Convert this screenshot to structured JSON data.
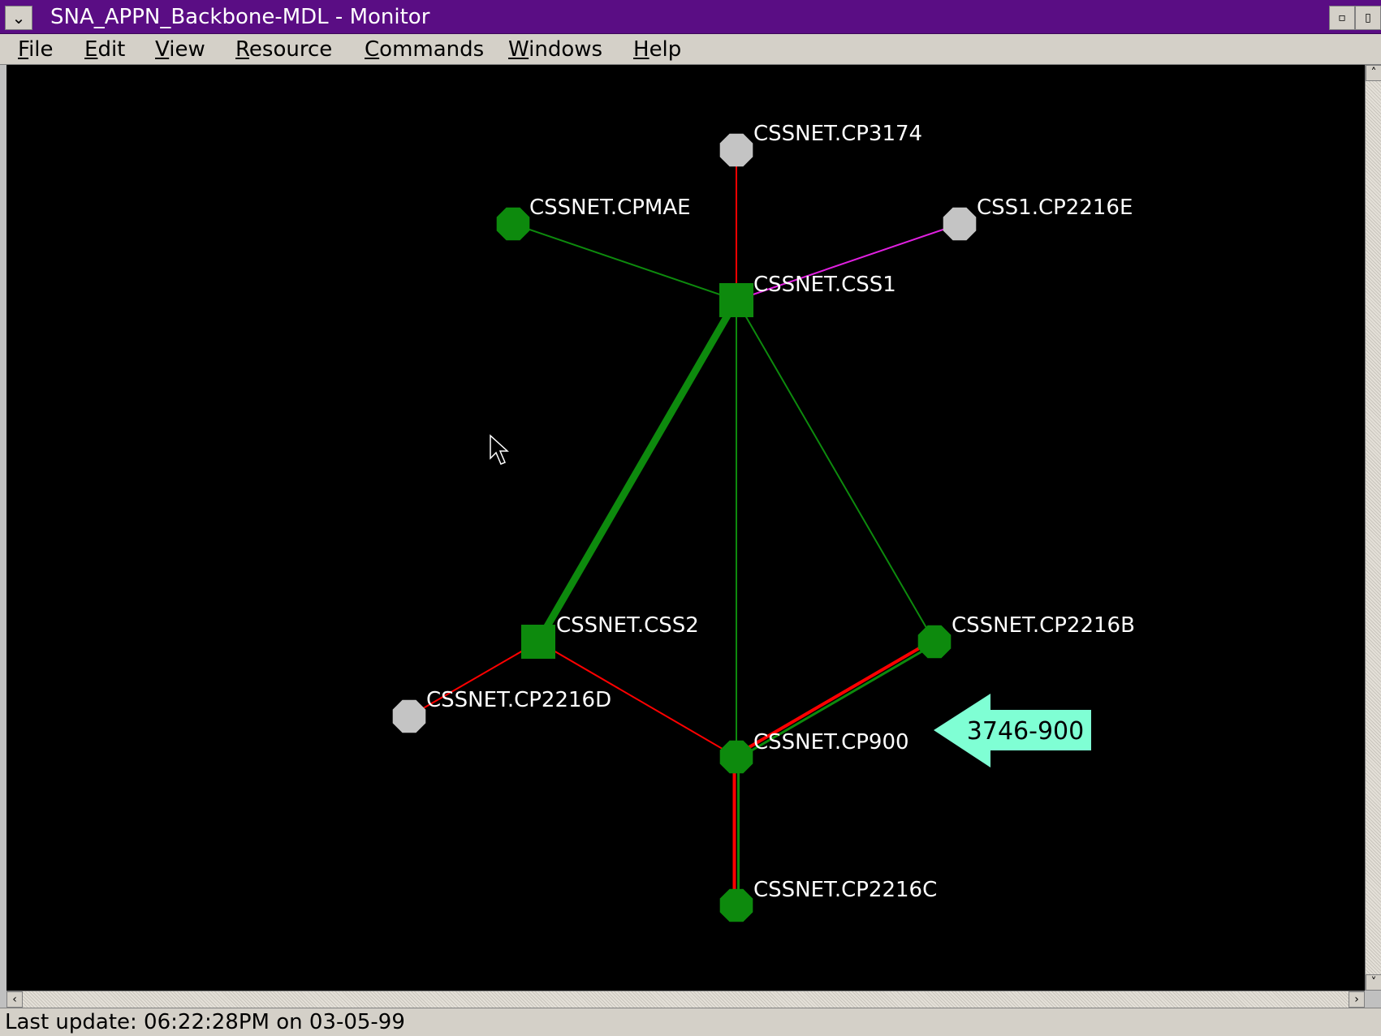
{
  "window": {
    "title": "SNA_APPN_Backbone-MDL - Monitor",
    "system_menu_glyph": "⌄",
    "minimize_glyph": "▫",
    "restore_glyph": "▯"
  },
  "menu": {
    "items": [
      {
        "label": "File"
      },
      {
        "label": "Edit"
      },
      {
        "label": "View"
      },
      {
        "label": "Resource"
      },
      {
        "label": "Commands"
      },
      {
        "label": "Windows"
      },
      {
        "label": "Help"
      }
    ]
  },
  "topology": {
    "background": "#000000",
    "colors": {
      "active_node": "#0d8a0d",
      "inactive_node": "#c4c4c4",
      "link_active": "#0d8a0d",
      "link_inactive": "#ff0000",
      "link_pending": "#e020e0",
      "label": "#ffffff"
    },
    "nodes": [
      {
        "id": "cp3174",
        "label": "CSSNET.CP3174",
        "shape": "octagon",
        "status": "inactive"
      },
      {
        "id": "cpmae",
        "label": "CSSNET.CPMAE",
        "shape": "octagon",
        "status": "active"
      },
      {
        "id": "cp2216e",
        "label": "CSS1.CP2216E",
        "shape": "octagon",
        "status": "inactive"
      },
      {
        "id": "css1",
        "label": "CSSNET.CSS1",
        "shape": "square",
        "status": "active"
      },
      {
        "id": "css2",
        "label": "CSSNET.CSS2",
        "shape": "square",
        "status": "active"
      },
      {
        "id": "cp2216b",
        "label": "CSSNET.CP2216B",
        "shape": "octagon",
        "status": "active"
      },
      {
        "id": "cp2216d",
        "label": "CSSNET.CP2216D",
        "shape": "octagon",
        "status": "inactive"
      },
      {
        "id": "cp900",
        "label": "CSSNET.CP900",
        "shape": "octagon",
        "status": "active"
      },
      {
        "id": "cp2216c",
        "label": "CSSNET.CP2216C",
        "shape": "octagon",
        "status": "active"
      }
    ],
    "links": [
      {
        "from": "cp3174",
        "to": "css1",
        "status": "inactive",
        "weight": "thin"
      },
      {
        "from": "cpmae",
        "to": "css1",
        "status": "active",
        "weight": "thin"
      },
      {
        "from": "cp2216e",
        "to": "css1",
        "status": "pending",
        "weight": "thin"
      },
      {
        "from": "css1",
        "to": "css2",
        "status": "active",
        "weight": "thick"
      },
      {
        "from": "css1",
        "to": "cp900",
        "status": "active",
        "weight": "thin"
      },
      {
        "from": "css1",
        "to": "cp2216b",
        "status": "active",
        "weight": "thin"
      },
      {
        "from": "css2",
        "to": "cp2216d",
        "status": "inactive",
        "weight": "thin"
      },
      {
        "from": "css2",
        "to": "cp900",
        "status": "inactive",
        "weight": "thin"
      },
      {
        "from": "cp2216b",
        "to": "cp900",
        "status": "mixed",
        "weight": "double"
      },
      {
        "from": "cp900",
        "to": "cp2216c",
        "status": "mixed",
        "weight": "double"
      }
    ],
    "callout": {
      "label": "3746-900",
      "color": "#7fffd4",
      "points_to": "cp900"
    }
  },
  "status": {
    "text": "Last update: 06:22:28PM on 03-05-99"
  }
}
